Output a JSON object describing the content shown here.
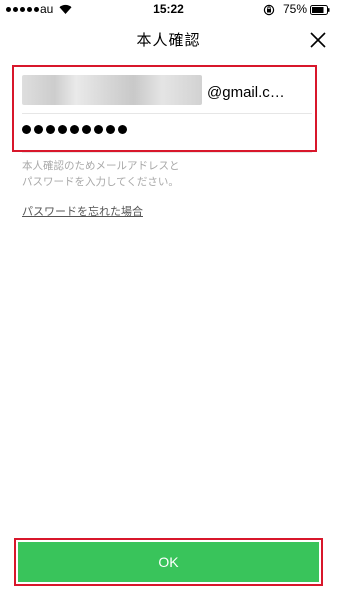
{
  "status_bar": {
    "carrier": "au",
    "time": "15:22",
    "battery_percent": "75%",
    "icons": [
      "signal-dots-icon",
      "wifi-icon",
      "rotation-lock-icon",
      "battery-icon"
    ]
  },
  "header": {
    "title": "本人確認",
    "close_icon": "close-icon"
  },
  "form": {
    "email_value_visible": "@gmail.c…",
    "password_value": "●●●●●●●●●",
    "helper_text": "本人確認のためメールアドレスと\nパスワードを入力してください。",
    "forgot_link": "パスワードを忘れた場合"
  },
  "footer": {
    "ok_label": "OK"
  },
  "colors": {
    "accent_green": "#39c45b",
    "highlight_red": "#d8172b",
    "helper_gray": "#a8a8a8"
  }
}
